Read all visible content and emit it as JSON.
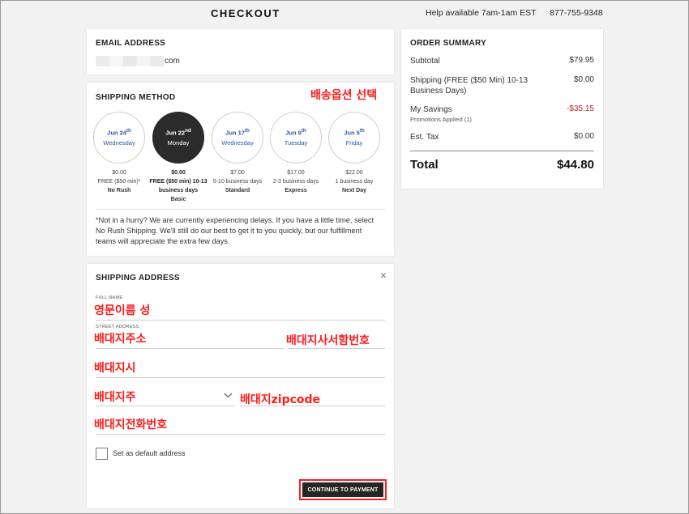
{
  "header": {
    "title": "CHECKOUT",
    "help_text": "Help available 7am-1am EST",
    "phone": "877-755-9348"
  },
  "email": {
    "title": "EMAIL ADDRESS",
    "domain_suffix": "com"
  },
  "shipping_method": {
    "title": "SHIPPING METHOD",
    "annotation": "배송옵션 선택",
    "options": [
      {
        "date": "Jun 24",
        "sup": "th",
        "day": "Wednesday",
        "price": "$0.00",
        "desc": "FREE ($50 min)*",
        "name": "No Rush",
        "selected": false
      },
      {
        "date": "Jun 22",
        "sup": "nd",
        "day": "Monday",
        "price": "$0.00",
        "desc": "FREE ($50 min) 10-13 business days",
        "name": "Basic",
        "selected": true
      },
      {
        "date": "Jun 17",
        "sup": "th",
        "day": "Wednesday",
        "price": "$7.00",
        "desc": "5-10 business days",
        "name": "Standard",
        "selected": false
      },
      {
        "date": "Jun 9",
        "sup": "th",
        "day": "Tuesday",
        "price": "$17.00",
        "desc": "2-3 business days",
        "name": "Express",
        "selected": false
      },
      {
        "date": "Jun 5",
        "sup": "th",
        "day": "Friday",
        "price": "$22.00",
        "desc": "1 business day",
        "name": "Next Day",
        "selected": false
      }
    ],
    "note": "*Not in a hurry? We are currently experiencing delays. If you have a little time, select No Rush Shipping. We'll still do our best to get it to you quickly, but our fulfillment teams will appreciate the extra few days."
  },
  "shipping_address": {
    "title": "SHIPPING ADDRESS",
    "close_icon": "×",
    "full_name_label": "FULL NAME",
    "full_name_annotation": "영문이름 성",
    "street_label": "STREET ADDRESS",
    "street_annotation": "배대지주소",
    "suite_annotation": "배대지사서함번호",
    "city_annotation": "배대지시",
    "state_annotation": "배대지주",
    "zip_annotation": "배대지zipcode",
    "phone_annotation": "배대지전화번호",
    "chevron_icon": "chevron-down-icon",
    "default_label": "Set as default address",
    "continue_label": "CONTINUE TO PAYMENT"
  },
  "order_summary": {
    "title": "ORDER SUMMARY",
    "subtotal_label": "Subtotal",
    "subtotal_value": "$79.95",
    "shipping_label": "Shipping (FREE ($50 Min) 10-13 Business Days)",
    "shipping_value": "$0.00",
    "savings_label": "My Savings",
    "savings_sub": "Promotions Applied (1)",
    "savings_value": "-$35.15",
    "tax_label": "Est. Tax",
    "tax_value": "$0.00",
    "total_label": "Total",
    "total_value": "$44.80"
  },
  "colors": {
    "accent_blue": "#2a5aa0",
    "annotation_red": "#ff1a1a",
    "savings_red": "#b3262b",
    "button_dark": "#262626"
  }
}
